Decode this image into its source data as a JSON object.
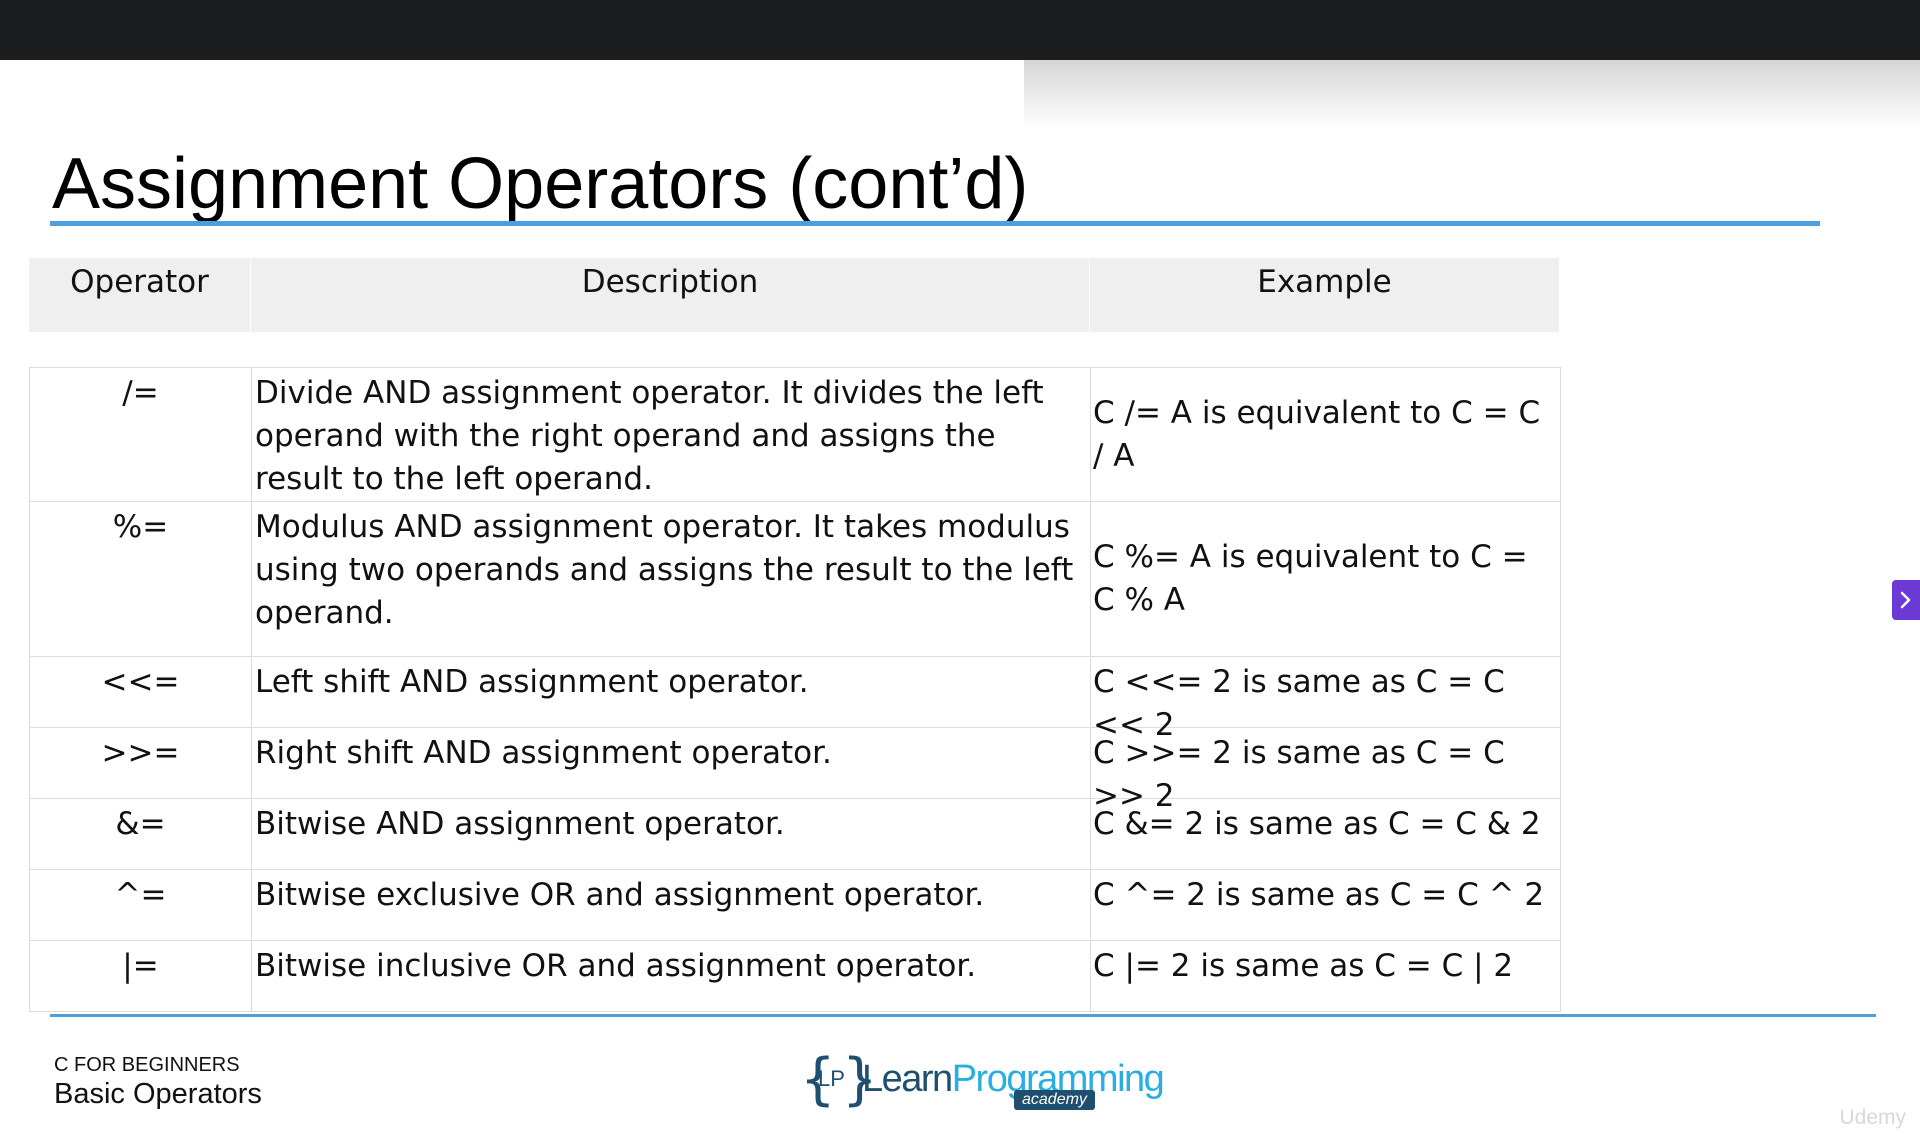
{
  "slide": {
    "title": "Assignment Operators (cont’d)",
    "footer": {
      "course": "C FOR BEGINNERS",
      "section": "Basic Operators"
    },
    "logo": {
      "mark": "LP",
      "word1": "Learn",
      "word2": "Programming",
      "badge": "academy"
    }
  },
  "table": {
    "headers": [
      "Operator",
      "Description",
      "Example"
    ],
    "rows": [
      {
        "operator": "/=",
        "description": "Divide AND assignment operator. It divides the left operand with the right operand and assigns the result to the left operand.",
        "example": "C /= A is equivalent to C = C / A"
      },
      {
        "operator": "%=",
        "description": "Modulus AND assignment operator. It takes modulus using two operands and assigns the result to the left operand.",
        "example": "C %= A is equivalent to C = C % A"
      },
      {
        "operator": "<<=",
        "description": "Left shift AND assignment operator.",
        "example": "C <<= 2 is same as C = C << 2"
      },
      {
        "operator": ">>=",
        "description": "Right shift AND assignment operator.",
        "example": "C >>= 2 is same as C = C >> 2"
      },
      {
        "operator": "&=",
        "description": "Bitwise AND assignment operator.",
        "example": "C &= 2 is same as C = C & 2"
      },
      {
        "operator": "^=",
        "description": "Bitwise exclusive OR and assignment operator.",
        "example": "C ^= 2 is same as C = C ^ 2"
      },
      {
        "operator": "|=",
        "description": "Bitwise inclusive OR and assignment operator.",
        "example": "C |= 2 is same as C = C | 2"
      }
    ]
  },
  "player": {
    "watermark": "Udemy",
    "next_icon": "chevron-right-icon"
  },
  "colors": {
    "accent_rule": "#4a9fdc",
    "header_bg": "#efefef",
    "top_bar": "#1c1d1f",
    "next_tab": "#6a39d6",
    "logo_dark": "#1f4f6e",
    "logo_light": "#2aaee0"
  }
}
